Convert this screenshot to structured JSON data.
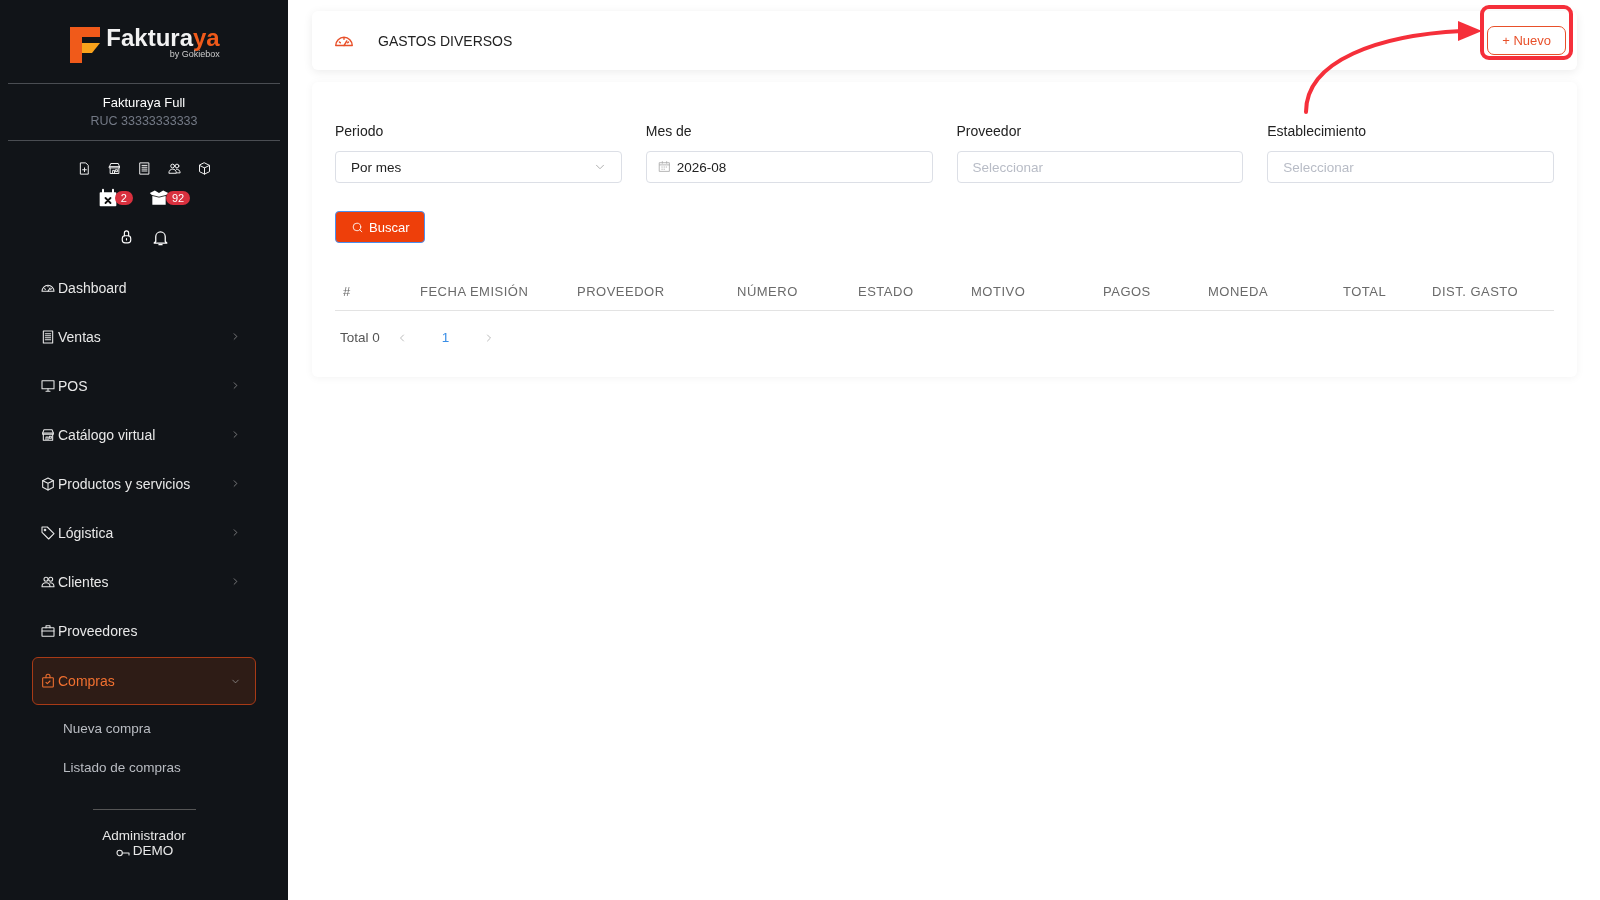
{
  "sidebar": {
    "logo": {
      "name": "Faktura",
      "accent": "ya",
      "tagline": "by Gokiebox"
    },
    "company": {
      "name": "Fakturaya Full",
      "ruc": "RUC 33333333333"
    },
    "badges": [
      {
        "count": "2"
      },
      {
        "count": "92"
      }
    ],
    "menu": [
      {
        "label": "Dashboard",
        "has_children": false,
        "expanded": false,
        "selected": false
      },
      {
        "label": "Ventas",
        "has_children": true,
        "expanded": false,
        "selected": false
      },
      {
        "label": "POS",
        "has_children": true,
        "expanded": false,
        "selected": false
      },
      {
        "label": "Catálogo virtual",
        "has_children": true,
        "expanded": false,
        "selected": false
      },
      {
        "label": "Productos y servicios",
        "has_children": true,
        "expanded": false,
        "selected": false
      },
      {
        "label": "Lógistica",
        "has_children": true,
        "expanded": false,
        "selected": false
      },
      {
        "label": "Clientes",
        "has_children": true,
        "expanded": false,
        "selected": false
      },
      {
        "label": "Proveedores",
        "has_children": false,
        "expanded": false,
        "selected": false
      },
      {
        "label": "Compras",
        "has_children": true,
        "expanded": true,
        "selected": true,
        "children": [
          {
            "label": "Nueva compra"
          },
          {
            "label": "Listado de compras"
          }
        ]
      }
    ],
    "user": {
      "role": "Administrador",
      "name": "DEMO"
    }
  },
  "header": {
    "title": "GASTOS DIVERSOS",
    "new_button": "+ Nuevo"
  },
  "filters": [
    {
      "label": "Periodo",
      "kind": "select",
      "value": "Por mes"
    },
    {
      "label": "Mes de",
      "kind": "date",
      "value": "2026-08"
    },
    {
      "label": "Proveedor",
      "kind": "input",
      "placeholder": "Seleccionar"
    },
    {
      "label": "Establecimiento",
      "kind": "input",
      "placeholder": "Seleccionar"
    }
  ],
  "search_button": "Buscar",
  "table": {
    "columns": [
      "#",
      "FECHA EMISIÓN",
      "PROVEEDOR",
      "NÚMERO",
      "ESTADO",
      "MOTIVO",
      "PAGOS",
      "MONEDA",
      "TOTAL",
      "DIST. GASTO"
    ]
  },
  "pagination": {
    "total": "Total 0",
    "pages": [
      {
        "label": "1",
        "selected": true
      }
    ]
  },
  "callout": {
    "arrow": true,
    "frame": true
  }
}
